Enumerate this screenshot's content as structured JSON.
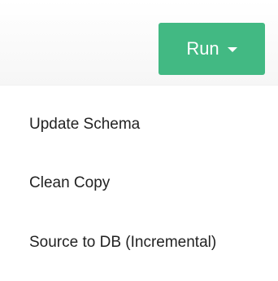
{
  "toolbar": {
    "run_button": {
      "label": "Run",
      "color": "#42b983",
      "caret_icon": "caret-down-icon"
    }
  },
  "dropdown": {
    "items": [
      {
        "label": "Update Schema"
      },
      {
        "label": "Clean Copy"
      },
      {
        "label": "Source to DB (Incremental)"
      }
    ]
  }
}
